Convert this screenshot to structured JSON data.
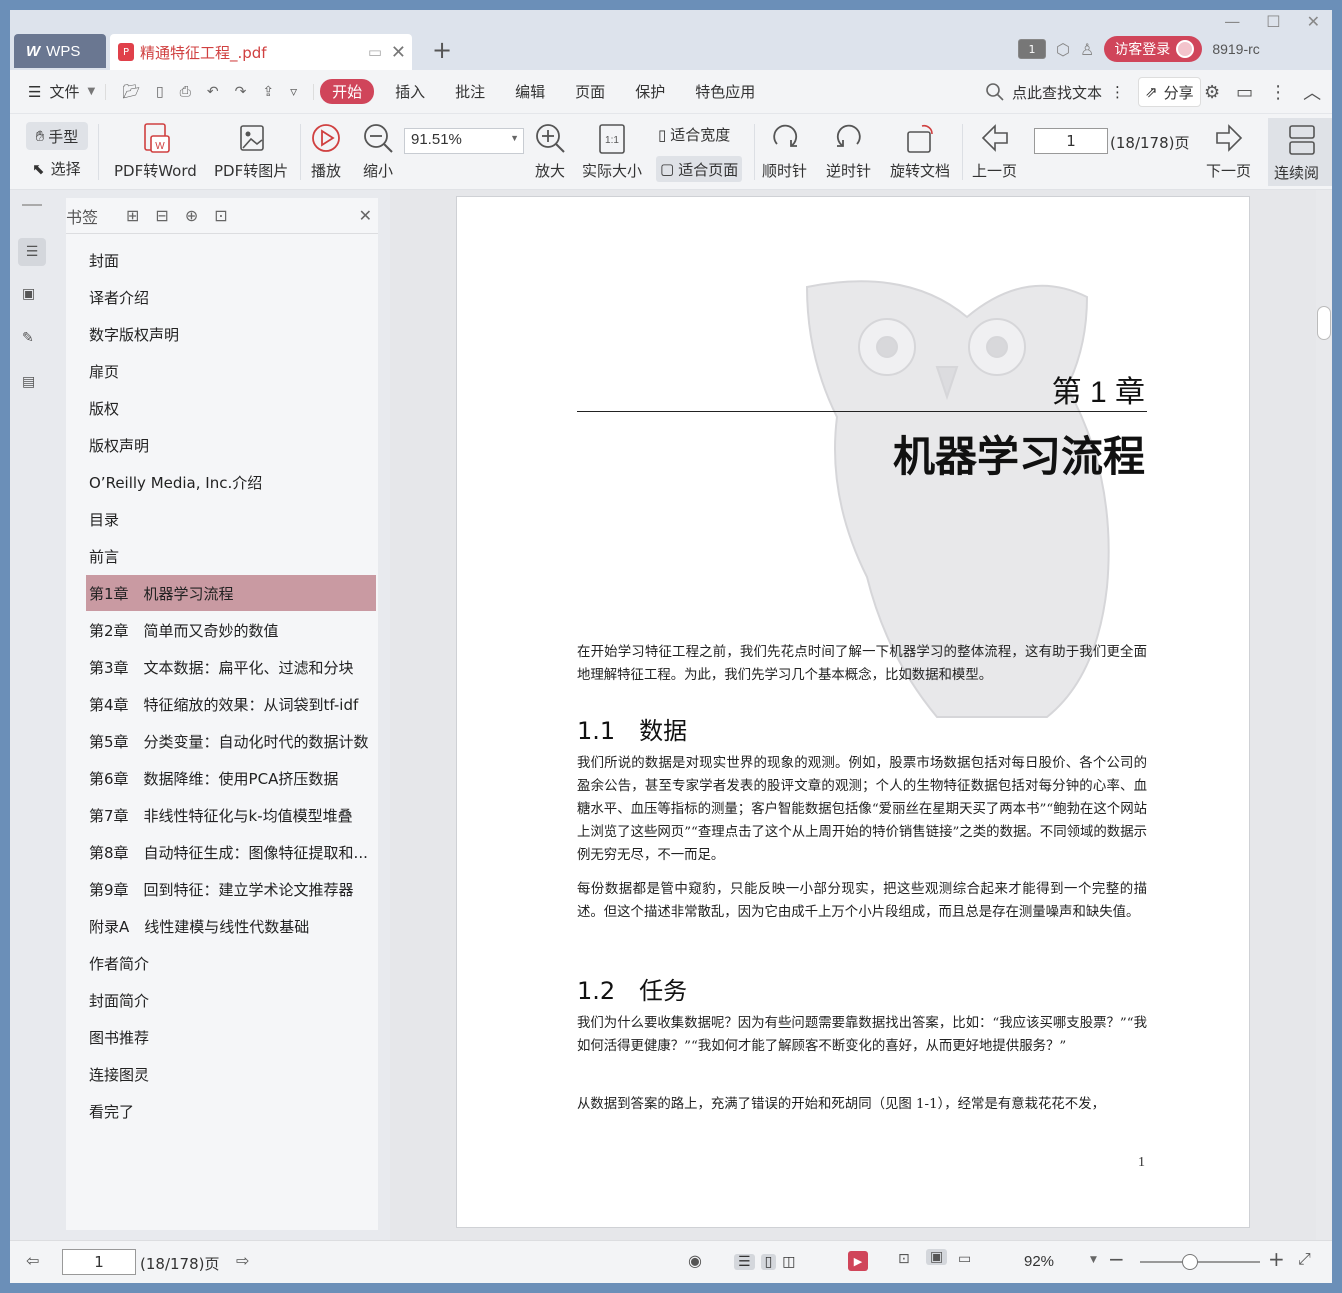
{
  "tabs": {
    "app": "WPS",
    "doc": "精通特征工程_.pdf",
    "add": "+"
  },
  "titlebar": {
    "badge": "1",
    "login": "访客登录",
    "user": "8919-rc"
  },
  "menu": {
    "file": "文件",
    "items": [
      "开始",
      "插入",
      "批注",
      "编辑",
      "页面",
      "保护",
      "特色应用"
    ],
    "search": "点此查找文本",
    "share": "分享"
  },
  "toolbar": {
    "hand": "手型",
    "select": "选择",
    "pdf2word": "PDF转Word",
    "pdf2img": "PDF转图片",
    "play": "播放",
    "zoomout": "缩小",
    "zoom": "91.51%",
    "zoomin": "放大",
    "actual": "实际大小",
    "fitwidth": "适合宽度",
    "fitpage": "适合页面",
    "cw": "顺时针",
    "ccw": "逆时针",
    "rotate": "旋转文档",
    "prev": "上一页",
    "page": "1",
    "pages": "(18/178)页",
    "next": "下一页",
    "continuous": "连续阅"
  },
  "bookmarks": {
    "title": "书签",
    "items": [
      {
        "label": "封面",
        "arrow": false
      },
      {
        "label": "译者介绍",
        "arrow": false
      },
      {
        "label": "数字版权声明",
        "arrow": false
      },
      {
        "label": "扉页",
        "arrow": false
      },
      {
        "label": "版权",
        "arrow": false
      },
      {
        "label": "版权声明",
        "arrow": false
      },
      {
        "label": "O’Reilly Media, Inc.介绍",
        "arrow": false
      },
      {
        "label": "目录",
        "arrow": false
      },
      {
        "label": "前言",
        "arrow": false
      },
      {
        "label": "第1章　机器学习流程",
        "arrow": true,
        "selected": true
      },
      {
        "label": "第2章　简单而又奇妙的数值",
        "arrow": true
      },
      {
        "label": "第3章　文本数据：扁平化、过滤和分块",
        "arrow": true
      },
      {
        "label": "第4章　特征缩放的效果：从词袋到tf-idf",
        "arrow": true
      },
      {
        "label": "第5章　分类变量：自动化时代的数据计数",
        "arrow": true
      },
      {
        "label": "第6章　数据降维：使用PCA挤压数据",
        "arrow": true
      },
      {
        "label": "第7章　非线性特征化与k-均值模型堆叠",
        "arrow": true
      },
      {
        "label": "第8章　自动特征生成：图像特征提取和...",
        "arrow": true
      },
      {
        "label": "第9章　回到特征：建立学术论文推荐器",
        "arrow": true
      },
      {
        "label": "附录A　线性建模与线性代数基础",
        "arrow": true
      },
      {
        "label": "作者简介",
        "arrow": false
      },
      {
        "label": "封面简介",
        "arrow": false
      },
      {
        "label": "图书推荐",
        "arrow": false
      },
      {
        "label": "连接图灵",
        "arrow": false
      },
      {
        "label": "看完了",
        "arrow": false
      }
    ]
  },
  "page": {
    "chapter_no": "第 1 章",
    "chapter_title": "机器学习流程",
    "intro": "在开始学习特征工程之前，我们先花点时间了解一下机器学习的整体流程，这有助于我们更全面地理解特征工程。为此，我们先学习几个基本概念，比如数据和模型。",
    "s1": "1.1　数据",
    "p1": "我们所说的数据是对现实世界的现象的观测。例如，股票市场数据包括对每日股价、各个公司的盈余公告，甚至专家学者发表的股评文章的观测；个人的生物特征数据包括对每分钟的心率、血糖水平、血压等指标的测量；客户智能数据包括像“爱丽丝在星期天买了两本书”“鲍勃在这个网站上浏览了这些网页”“查理点击了这个从上周开始的特价销售链接”之类的数据。不同领域的数据示例无穷无尽，不一而足。",
    "p2": "每份数据都是管中窥豹，只能反映一小部分现实，把这些观测综合起来才能得到一个完整的描述。但这个描述非常散乱，因为它由成千上万个小片段组成，而且总是存在测量噪声和缺失值。",
    "s2": "1.2　任务",
    "p3": "我们为什么要收集数据呢？因为有些问题需要靠数据找出答案，比如：“我应该买哪支股票？”“我如何活得更健康？”“我如何才能了解顾客不断变化的喜好，从而更好地提供服务？”",
    "p4": "从数据到答案的路上，充满了错误的开始和死胡同（见图 1-1），经常是有意栽花花不发，",
    "num": "1"
  },
  "status": {
    "page": "1",
    "pages": "(18/178)页",
    "zoom": "92%"
  }
}
